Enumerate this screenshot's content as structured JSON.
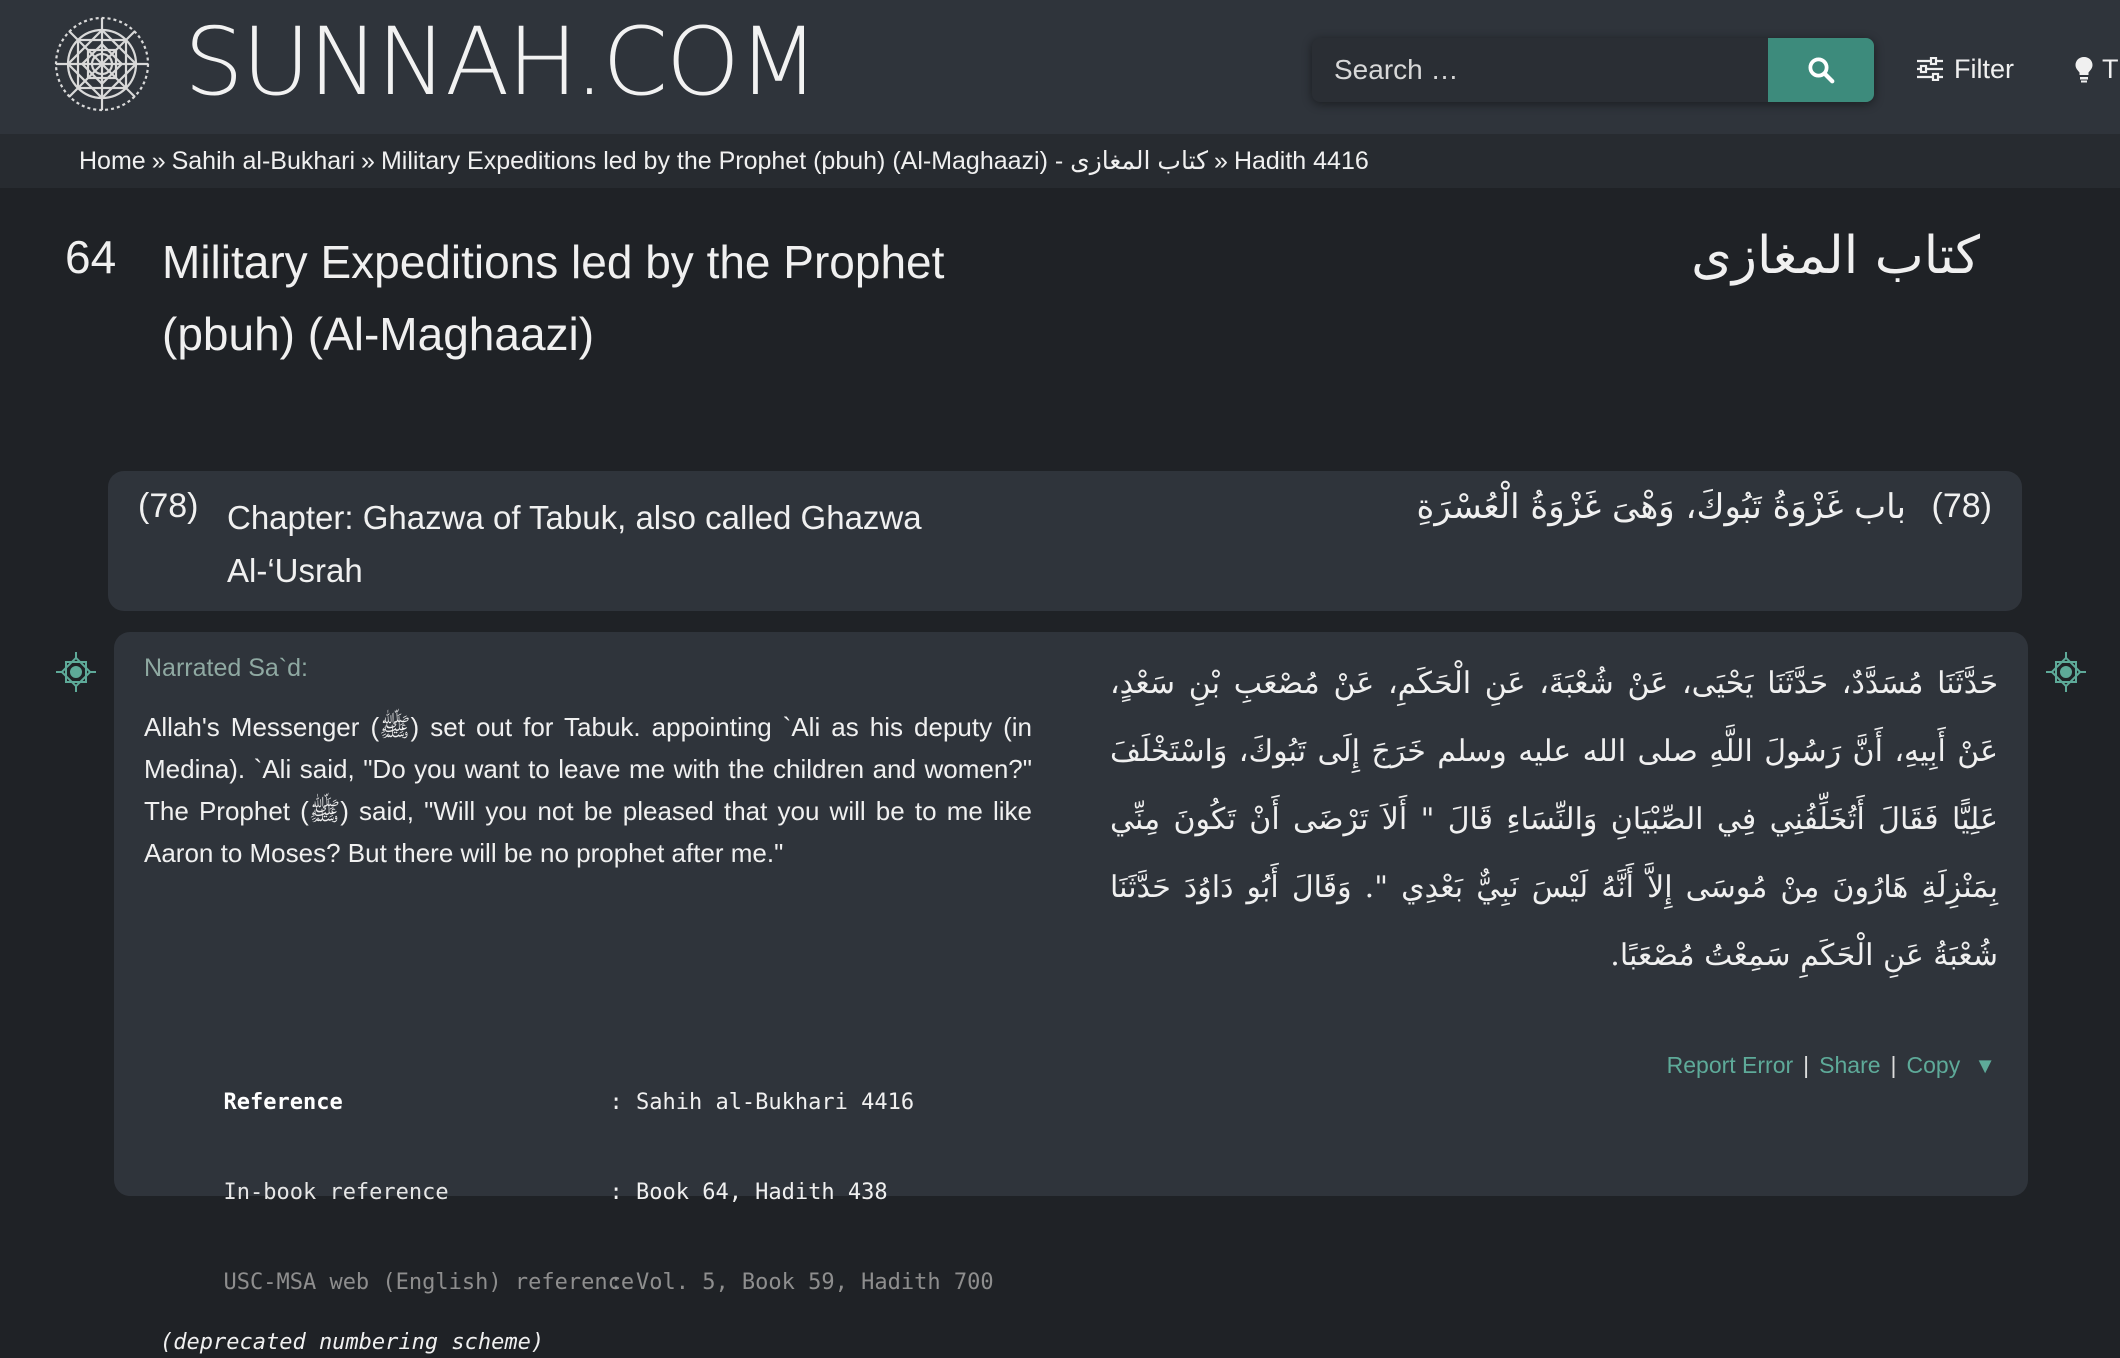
{
  "header": {
    "logo_text": "SUNNAH.COM",
    "search_placeholder": "Search …",
    "filter_label": "Filter",
    "theme_label": "T",
    "accent_color": "#3d8b7c",
    "icons": [
      "geometric-logo-icon",
      "search-icon",
      "sliders-icon",
      "lightbulb-icon"
    ]
  },
  "breadcrumb": {
    "items": [
      "Home",
      "Sahih al-Bukhari",
      "Military Expeditions led by the Prophet (pbuh) (Al-Maghaazi) - كتاب المغازى",
      "Hadith 4416"
    ],
    "separator": "»"
  },
  "book": {
    "number": "64",
    "title_en": "Military Expeditions led by the Prophet (pbuh) (Al-Maghaazi)",
    "title_ar": "كتاب المغازى"
  },
  "chapter": {
    "number": "(78)",
    "title_en": "Chapter: Ghazwa of Tabuk, also called Ghazwa Al-‘Usrah",
    "number_ar": "(78)",
    "title_ar": "باب غَزْوَةُ تَبُوكَ، وَهْىَ غَزْوَةُ الْعُسْرَةِ"
  },
  "hadith": {
    "narrator": "Narrated Sa`d:",
    "text_en": "Allah's Messenger (ﷺ) set out for Tabuk. appointing `Ali as his deputy (in Medina). `Ali said, \"Do you want to leave me with the children and women?\" The Prophet (ﷺ) said, \"Will you not be pleased that you will be to me like Aaron to Moses? But there will be no prophet after me.\"",
    "text_ar": "حَدَّثَنَا مُسَدَّدٌ، حَدَّثَنَا يَحْيَى، عَنْ شُعْبَةَ، عَنِ الْحَكَمِ، عَنْ مُصْعَبِ بْنِ سَعْدٍ، عَنْ أَبِيهِ، أَنَّ رَسُولَ اللَّهِ صلى الله عليه وسلم خَرَجَ إِلَى تَبُوكَ، وَاسْتَخْلَفَ عَلِيًّا فَقَالَ أَتُخَلِّفُنِي فِي الصِّبْيَانِ وَالنِّسَاءِ قَالَ \" أَلاَ تَرْضَى أَنْ تَكُونَ مِنِّي بِمَنْزِلَةِ هَارُونَ مِنْ مُوسَى إِلاَّ أَنَّهُ لَيْسَ نَبِيٌّ بَعْدِي \". وَقَالَ أَبُو دَاوُدَ حَدَّثَنَا شُعْبَةُ عَنِ الْحَكَمِ سَمِعْتُ مُصْعَبًا."
  },
  "references": {
    "reference_label": "Reference",
    "reference_value": ": Sahih al-Bukhari 4416",
    "inbook_label": "In-book reference",
    "inbook_value": ": Book 64, Hadith 438",
    "usc_label": "USC-MSA web (English) reference",
    "usc_value": ": Vol. 5, Book 59, Hadith 700",
    "deprecated_note": "(deprecated numbering scheme)"
  },
  "actions": {
    "report_error": "Report Error",
    "share": "Share",
    "copy": "Copy",
    "copy_arrow": "▼",
    "pipe": "|"
  }
}
